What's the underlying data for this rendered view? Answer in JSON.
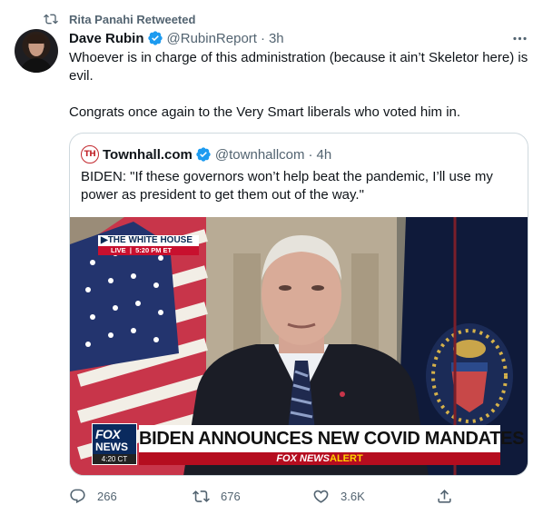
{
  "retweet_context": {
    "text": "Rita Panahi Retweeted",
    "icon": "retweet-icon"
  },
  "tweet": {
    "author_name": "Dave Rubin",
    "handle": "@RubinReport",
    "separator": "·",
    "time": "3h",
    "verified": true,
    "text_line1": "Whoever is in charge of this administration (because it ain’t Skeletor here) is evil.",
    "text_line2": "Congrats once again to the Very Smart liberals who voted him in."
  },
  "quote": {
    "avatar_text": "TH",
    "author_name": "Townhall.com",
    "handle": "@townhallcom",
    "separator": "·",
    "time": "4h",
    "verified": true,
    "text": "BIDEN: \"If these governors won’t help beat the pandemic, I’ll use my power as president to get them out of the way.\""
  },
  "media": {
    "bug_top": "▶THE WHITE HOUSE",
    "bug_live": "LIVE",
    "bug_time": "5:20 PM ET",
    "fox_logo_line1": "FOX",
    "fox_logo_line2": "NEWS",
    "clock": "4:20 CT",
    "headline": "BIDEN ANNOUNCES NEW COVID MANDATES",
    "alert_brand": "FOX NEWS",
    "alert_word": "ALERT"
  },
  "actions": {
    "reply_count": "266",
    "retweet_count": "676",
    "like_count": "3.6K"
  },
  "colors": {
    "verified_blue": "#1d9bf0",
    "secondary_text": "#536471",
    "fox_red": "#b50d1f"
  }
}
